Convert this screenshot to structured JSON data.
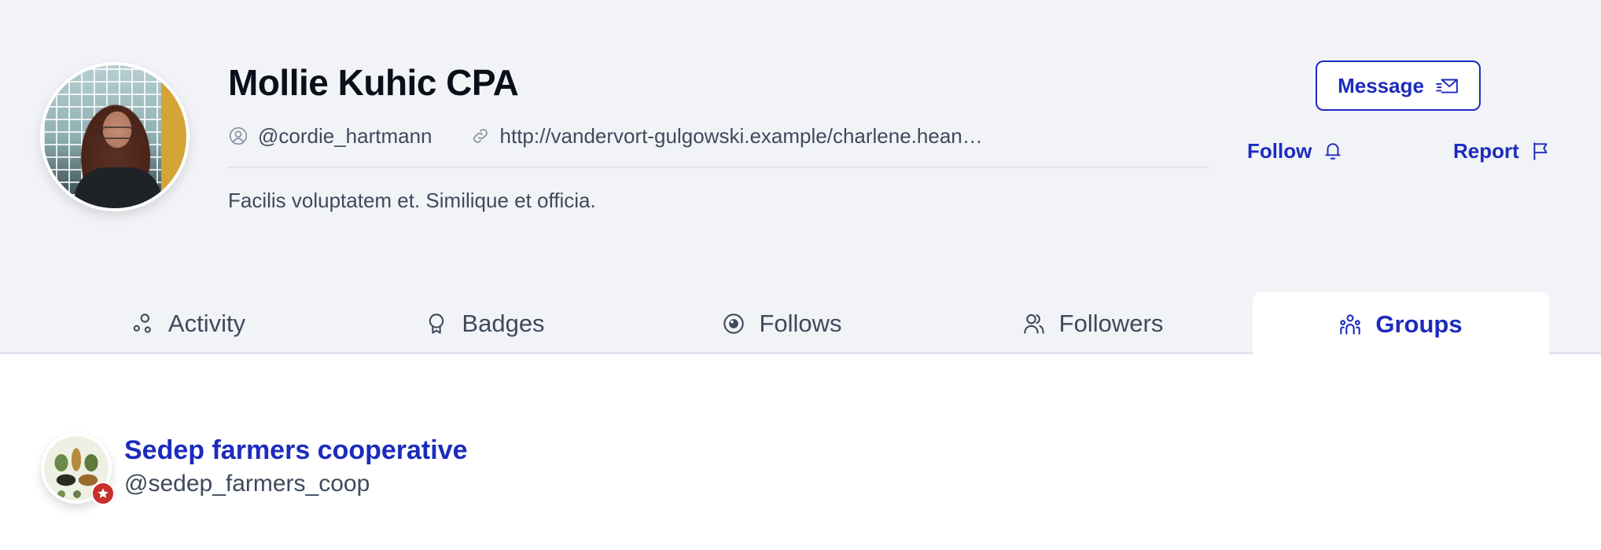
{
  "profile": {
    "name": "Mollie Kuhic CPA",
    "username": "@cordie_hartmann",
    "website": "http://vandervort-gulgowski.example/charlene.hean…",
    "bio": "Facilis voluptatem et. Similique et officia.",
    "avatar_alt": "profile-photo"
  },
  "actions": {
    "message_label": "Message",
    "follow_label": "Follow",
    "report_label": "Report"
  },
  "icons": {
    "username": "user-circle-icon",
    "website": "link-icon",
    "message": "mail-send-icon",
    "follow": "bell-icon",
    "report": "flag-icon"
  },
  "tabs": [
    {
      "label": "Activity",
      "icon": "activity-icon",
      "active": false
    },
    {
      "label": "Badges",
      "icon": "badge-icon",
      "active": false
    },
    {
      "label": "Follows",
      "icon": "eye-icon",
      "active": false
    },
    {
      "label": "Followers",
      "icon": "users-icon",
      "active": false
    },
    {
      "label": "Groups",
      "icon": "group-icon",
      "active": true
    }
  ],
  "groups": [
    {
      "title": "Sedep farmers cooperative",
      "handle": "@sedep_farmers_coop",
      "badge": "star-icon"
    }
  ],
  "colors": {
    "accent": "#1c2bbd",
    "header_bg": "#f2f3f7",
    "text": "#3e4a5c",
    "title": "#0b0f19",
    "badge": "#c8302a",
    "divider": "#e1e5ee"
  }
}
